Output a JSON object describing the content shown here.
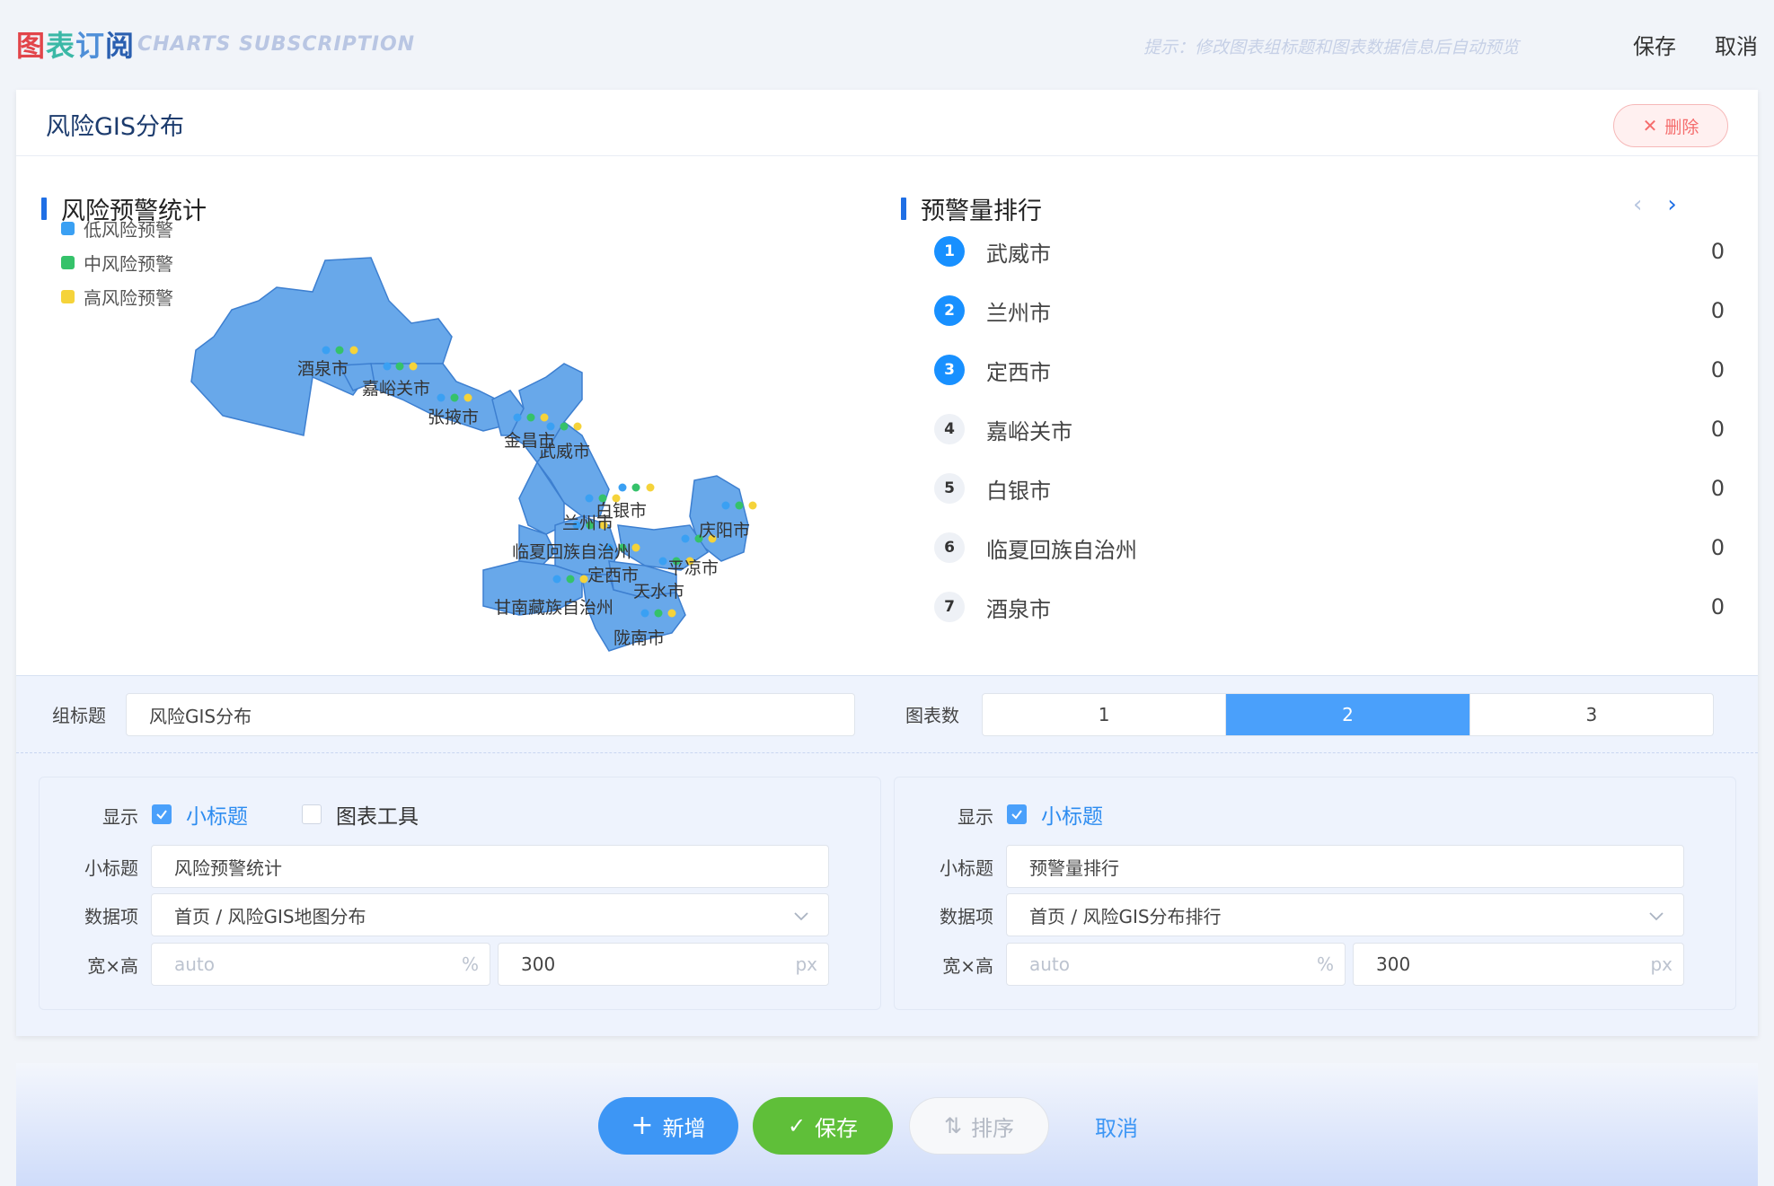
{
  "header": {
    "brand_chars": [
      "图",
      "表",
      "订",
      "阅"
    ],
    "brand_colors": [
      "#e2454a",
      "#3bb8a6",
      "#4f8fd8",
      "#2a5fb0"
    ],
    "brand_en": "CHARTS SUBSCRIPTION",
    "hint": "提示：修改图表组标题和图表数据信息后自动预览",
    "save": "保存",
    "cancel": "取消"
  },
  "group": {
    "title": "风险GIS分布",
    "delete_label": "删除"
  },
  "chart_left": {
    "subtitle": "风险预警统计",
    "legend": [
      {
        "label": "低风险预警",
        "color": "#3aa0f3"
      },
      {
        "label": "中风险预警",
        "color": "#35c26a"
      },
      {
        "label": "高风险预警",
        "color": "#f5d33a"
      }
    ],
    "regions": [
      "酒泉市",
      "嘉峪关市",
      "张掖市",
      "金昌市",
      "武威市",
      "白银市",
      "兰州市",
      "庆阳市",
      "临夏回族自治州",
      "定西市",
      "平凉市",
      "天水市",
      "甘南藏族自治州",
      "陇南市"
    ]
  },
  "chart_right": {
    "subtitle": "预警量排行",
    "ranking": [
      {
        "rank": "1",
        "name": "武威市",
        "value": "0"
      },
      {
        "rank": "2",
        "name": "兰州市",
        "value": "0"
      },
      {
        "rank": "3",
        "name": "定西市",
        "value": "0"
      },
      {
        "rank": "4",
        "name": "嘉峪关市",
        "value": "0"
      },
      {
        "rank": "5",
        "name": "白银市",
        "value": "0"
      },
      {
        "rank": "6",
        "name": "临夏回族自治州",
        "value": "0"
      },
      {
        "rank": "7",
        "name": "酒泉市",
        "value": "0"
      }
    ]
  },
  "settings": {
    "group_title_label": "组标题",
    "group_title_value": "风险GIS分布",
    "chart_count_label": "图表数",
    "chart_count_options": [
      "1",
      "2",
      "3"
    ],
    "chart_count_selected": "2",
    "panels": [
      {
        "display_label": "显示",
        "opt_subtitle": "小标题",
        "opt_tools": "图表工具",
        "subtitle_label": "小标题",
        "subtitle_value": "风险预警统计",
        "data_label": "数据项",
        "data_value": "首页 / 风险GIS地图分布",
        "size_label": "宽×高",
        "width_placeholder": "auto",
        "width_unit": "%",
        "height_value": "300",
        "height_unit": "px"
      },
      {
        "display_label": "显示",
        "opt_subtitle": "小标题",
        "subtitle_label": "小标题",
        "subtitle_value": "预警量排行",
        "data_label": "数据项",
        "data_value": "首页 / 风险GIS分布排行",
        "size_label": "宽×高",
        "width_placeholder": "auto",
        "width_unit": "%",
        "height_value": "300",
        "height_unit": "px"
      }
    ]
  },
  "footer": {
    "add": "新增",
    "save": "保存",
    "sort": "排序",
    "cancel": "取消"
  }
}
